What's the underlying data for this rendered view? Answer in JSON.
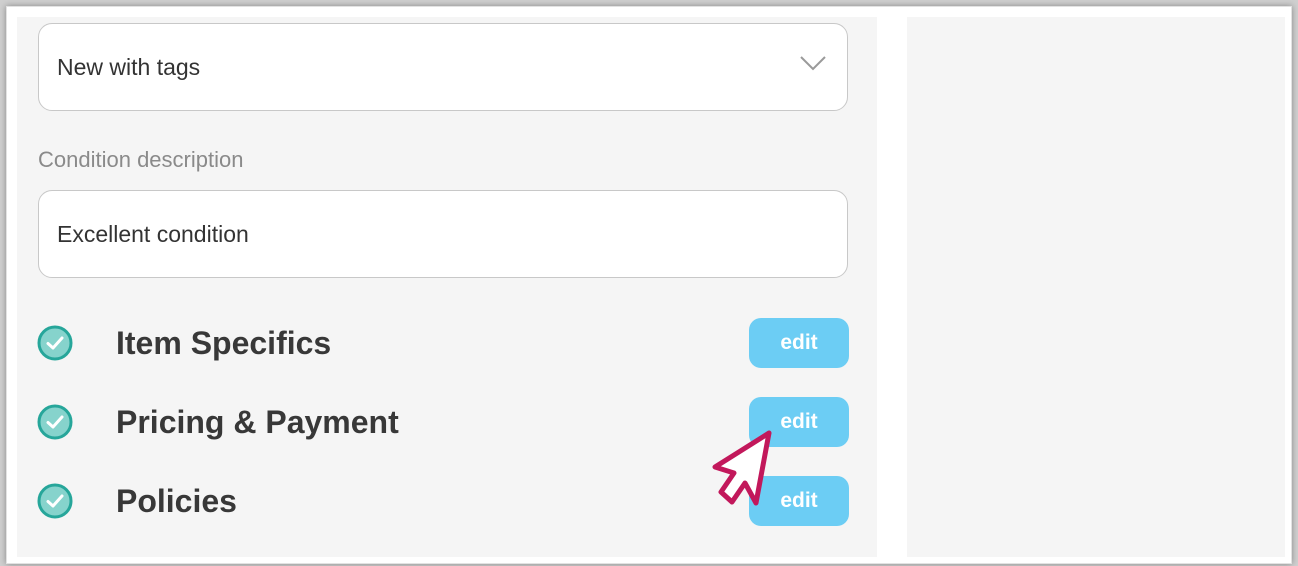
{
  "condition_select": {
    "value": "New with tags",
    "icon": "chevron-down-icon"
  },
  "condition_description": {
    "label": "Condition description",
    "value": "Excellent condition"
  },
  "sections": [
    {
      "title": "Item Specifics",
      "edit_label": "edit",
      "status": "complete"
    },
    {
      "title": "Pricing & Payment",
      "edit_label": "edit",
      "status": "complete"
    },
    {
      "title": "Policies",
      "edit_label": "edit",
      "status": "complete"
    }
  ],
  "colors": {
    "check": "#26a69a",
    "check_fill": "#86d3cc",
    "edit_button": "#6ccdf4",
    "cursor": "#c2185b"
  }
}
